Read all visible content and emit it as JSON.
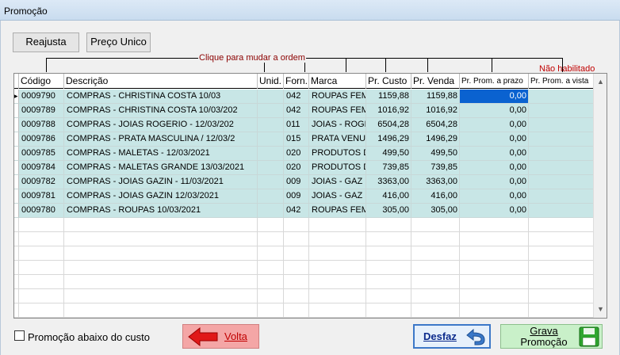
{
  "window": {
    "title": "Promoção"
  },
  "toolbar": {
    "reajusta_label": "Reajusta",
    "preco_label": "Preço Unico"
  },
  "order_hint": "Clique para mudar a ordem",
  "not_enabled": "Não habilitado",
  "columns": [
    "Código",
    "Descrição",
    "Unid.",
    "Forn.",
    "Marca",
    "Pr. Custo",
    "Pr. Venda",
    "Pr. Prom. a prazo",
    "Pr. Prom. a vista"
  ],
  "rows": [
    {
      "codigo": "0009790",
      "descricao": "COMPRAS - CHRISTINA COSTA 10/03",
      "unid": "",
      "forn": "042",
      "marca": "ROUPAS FEME",
      "custo": "1159,88",
      "venda": "1159,88",
      "prazo": "0,00",
      "vista": ""
    },
    {
      "codigo": "0009789",
      "descricao": "COMPRAS - CHRISTINA COSTA 10/03/202",
      "unid": "",
      "forn": "042",
      "marca": "ROUPAS FEME",
      "custo": "1016,92",
      "venda": "1016,92",
      "prazo": "0,00",
      "vista": ""
    },
    {
      "codigo": "0009788",
      "descricao": "COMPRAS - JOIAS ROGERIO - 12/03/202",
      "unid": "",
      "forn": "011",
      "marca": "JOIAS - ROGE",
      "custo": "6504,28",
      "venda": "6504,28",
      "prazo": "0,00",
      "vista": ""
    },
    {
      "codigo": "0009786",
      "descricao": "COMPRAS - PRATA MASCULINA / 12/03/2",
      "unid": "",
      "forn": "015",
      "marca": "PRATA VENUS",
      "custo": "1496,29",
      "venda": "1496,29",
      "prazo": "0,00",
      "vista": ""
    },
    {
      "codigo": "0009785",
      "descricao": "COMPRAS - MALETAS - 12/03/2021",
      "unid": "",
      "forn": "020",
      "marca": "PRODUTOS DI",
      "custo": "499,50",
      "venda": "499,50",
      "prazo": "0,00",
      "vista": ""
    },
    {
      "codigo": "0009784",
      "descricao": "COMPRAS - MALETAS GRANDE 13/03/2021",
      "unid": "",
      "forn": "020",
      "marca": "PRODUTOS DI",
      "custo": "739,85",
      "venda": "739,85",
      "prazo": "0,00",
      "vista": ""
    },
    {
      "codigo": "0009782",
      "descricao": "COMPRAS - JOIAS GAZIN - 11/03/2021",
      "unid": "",
      "forn": "009",
      "marca": "JOIAS - GAZ",
      "custo": "3363,00",
      "venda": "3363,00",
      "prazo": "0,00",
      "vista": ""
    },
    {
      "codigo": "0009781",
      "descricao": "COMPRAS - JOIAS GAZIN 12/03/2021",
      "unid": "",
      "forn": "009",
      "marca": "JOIAS - GAZ",
      "custo": "416,00",
      "venda": "416,00",
      "prazo": "0,00",
      "vista": ""
    },
    {
      "codigo": "0009780",
      "descricao": "COMPRAS - ROUPAS 10/03/2021",
      "unid": "",
      "forn": "042",
      "marca": "ROUPAS FEME",
      "custo": "305,00",
      "venda": "305,00",
      "prazo": "0,00",
      "vista": ""
    }
  ],
  "footer": {
    "checkbox_label": "Promoção abaixo do custo",
    "volta_label": "Volta",
    "desfaz_label": "Desfaz",
    "grava_label_1": "Grava",
    "grava_label_2": "Promoção"
  },
  "colors": {
    "row_bg": "#c8e6e6",
    "selected_bg": "#0a62d0",
    "accent_red": "#c00000"
  },
  "icons": {
    "volta": "arrow-left-icon",
    "desfaz": "undo-arrow-icon",
    "grava": "floppy-disk-icon",
    "scroll_up": "chevron-up-icon",
    "scroll_down": "chevron-down-icon"
  }
}
